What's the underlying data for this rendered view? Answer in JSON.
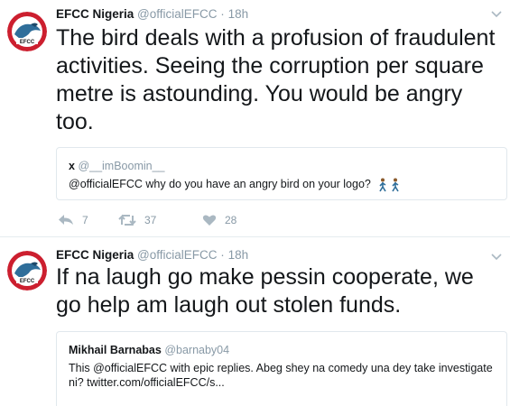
{
  "tweets": [
    {
      "name": "EFCC Nigeria",
      "handle": "@officialEFCC",
      "separator": "·",
      "time": "18h",
      "text": "The bird deals with a profusion of fraudulent activities. Seeing the corruption per square metre is astounding. You would be angry too.",
      "quote": {
        "name": "x",
        "handle": "@__imBoomin__",
        "text": "@officialEFCC why do you have an angry bird on your logo?"
      },
      "actions": {
        "replies": "7",
        "retweets": "37",
        "likes": "28"
      }
    },
    {
      "name": "EFCC Nigeria",
      "handle": "@officialEFCC",
      "separator": "·",
      "time": "18h",
      "text": "If na laugh go make pessin cooperate, we go help am laugh out stolen funds.",
      "quote": {
        "name": "Mikhail Barnabas",
        "handle": "@barnaby04",
        "text": "This @officialEFCC with epic replies. Abeg shey na comedy una dey take investigate ni? twitter.com/officialEFCC/s..."
      }
    }
  ],
  "avatar_logo_text": "EFCC",
  "colors": {
    "muted": "#8899a6",
    "text": "#14171a",
    "border": "#e1e8ed",
    "logo_red": "#cc1f2f"
  }
}
